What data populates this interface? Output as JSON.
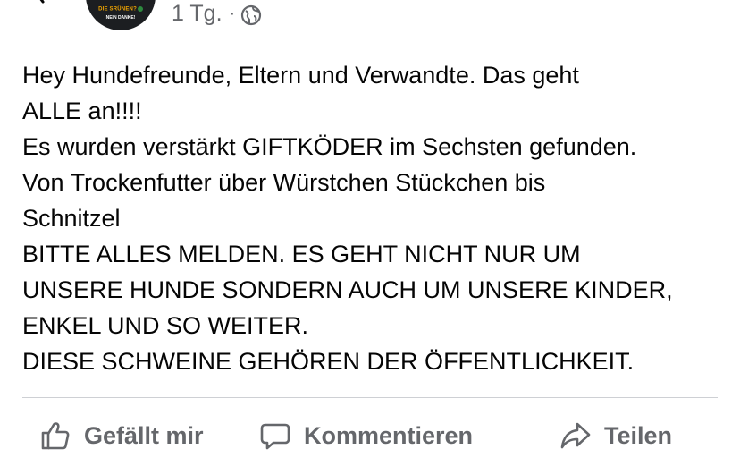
{
  "post": {
    "avatar": {
      "line1": "DIE SRÜNEN?",
      "line2": "NEIN DANKE!"
    },
    "timestamp": "1 Tg.",
    "separator": "·",
    "audience_icon": "globe-icon",
    "body_lines": [
      "Hey Hundefreunde, Eltern und Verwandte. Das geht",
      "ALLE an!!!!",
      "Es wurden verstärkt GIFTKÖDER im Sechsten gefunden.",
      "Von Trockenfutter über Würstchen Stückchen bis",
      "Schnitzel",
      "BITTE ALLES MELDEN. ES GEHT NICHT NUR UM",
      "UNSERE HUNDE SONDERN AUCH UM UNSERE KINDER,",
      "ENKEL UND SO WEITER.",
      "DIESE SCHWEINE GEHÖREN DER ÖFFENTLICHKEIT."
    ]
  },
  "actions": {
    "like": {
      "label": "Gefällt mir",
      "icon": "thumbs-up-icon"
    },
    "comment": {
      "label": "Kommentieren",
      "icon": "comment-icon"
    },
    "share": {
      "label": "Teilen",
      "icon": "share-icon"
    }
  },
  "colors": {
    "text": "#050505",
    "secondary_text": "#65676b",
    "divider": "#ced0d4",
    "background": "#ffffff"
  }
}
